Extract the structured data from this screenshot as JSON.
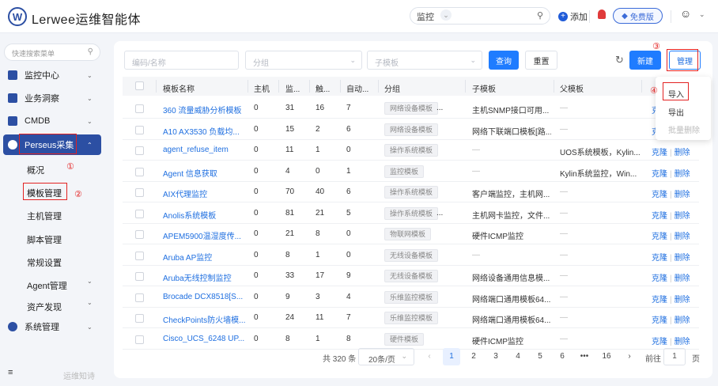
{
  "app": {
    "name": "Lerwee运维智能体",
    "logo_letter": "W"
  },
  "topbar": {
    "search_scope": "监控",
    "add_label": "添加",
    "badge_label": "免费版"
  },
  "sidebar": {
    "search_placeholder": "快速搜索菜单",
    "items": [
      {
        "label": "监控中心"
      },
      {
        "label": "业务洞察"
      },
      {
        "label": "CMDB"
      },
      {
        "label": "Perseus采集"
      },
      {
        "label": "系统管理"
      }
    ],
    "subitems": [
      "概况",
      "模板管理",
      "主机管理",
      "脚本管理",
      "常规设置",
      "Agent管理",
      "资产发现"
    ],
    "footer_label": "运维知诗"
  },
  "annotations": [
    "①",
    "②",
    "③",
    "④"
  ],
  "filters": {
    "name_placeholder": "编码/名称",
    "group_placeholder": "分组",
    "subtemplate_placeholder": "子模板",
    "query_label": "查询",
    "reset_label": "重置",
    "new_label": "新建",
    "manage_label": "管理"
  },
  "manage_menu": [
    "导入",
    "导出",
    "批量删除"
  ],
  "table": {
    "headers": [
      "模板名称",
      "主机",
      "监...",
      "触...",
      "自动...",
      "分组",
      "子模板",
      "父模板"
    ],
    "rows": [
      {
        "name": "360 流量威胁分析模板",
        "host": "0",
        "mon": "31",
        "trig": "16",
        "auto": "7",
        "group": "网络设备模板",
        "group_more": "...",
        "sub": "主机SNMP接口可用...",
        "parent": "—",
        "ops": [
          "克隆",
          "删除"
        ]
      },
      {
        "name": "A10 AX3530 负载均...",
        "host": "0",
        "mon": "15",
        "trig": "2",
        "auto": "6",
        "group": "网络设备模板",
        "group_more": "",
        "sub": "网络下联端口模板[路...",
        "parent": "—",
        "ops": [
          "克隆",
          "删除"
        ]
      },
      {
        "name": "agent_refuse_item",
        "host": "0",
        "mon": "11",
        "trig": "1",
        "auto": "0",
        "group": "操作系统模板",
        "group_more": "",
        "sub": "—",
        "parent": "UOS系统模板，Kylin...",
        "ops": [
          "克隆",
          "删除"
        ]
      },
      {
        "name": "Agent 信息获取",
        "host": "0",
        "mon": "4",
        "trig": "0",
        "auto": "1",
        "group": "监控模板",
        "group_more": "",
        "sub": "—",
        "parent": "Kylin系统监控，Win...",
        "ops": [
          "克隆",
          "删除"
        ]
      },
      {
        "name": "AIX代理监控",
        "host": "0",
        "mon": "70",
        "trig": "40",
        "auto": "6",
        "group": "操作系统模板",
        "group_more": "",
        "sub": "客户端监控，主机网...",
        "parent": "—",
        "ops": [
          "克隆",
          "删除"
        ]
      },
      {
        "name": "Anolis系统模板",
        "host": "0",
        "mon": "81",
        "trig": "21",
        "auto": "5",
        "group": "操作系统模板",
        "group_more": "...",
        "sub": "主机网卡监控，文件...",
        "parent": "—",
        "ops": [
          "克隆",
          "删除"
        ]
      },
      {
        "name": "APEM5900温湿度传...",
        "host": "0",
        "mon": "21",
        "trig": "8",
        "auto": "0",
        "group": "物联网模板",
        "group_more": "",
        "sub": "硬件ICMP监控",
        "parent": "—",
        "ops": [
          "克隆",
          "删除"
        ]
      },
      {
        "name": "Aruba AP监控",
        "host": "0",
        "mon": "8",
        "trig": "1",
        "auto": "0",
        "group": "无线设备模板",
        "group_more": "",
        "sub": "—",
        "parent": "—",
        "ops": [
          "克隆",
          "删除"
        ]
      },
      {
        "name": "Aruba无线控制监控",
        "host": "0",
        "mon": "33",
        "trig": "17",
        "auto": "9",
        "group": "无线设备模板",
        "group_more": "",
        "sub": "网络设备通用信息模...",
        "parent": "—",
        "ops": [
          "克隆",
          "删除"
        ]
      },
      {
        "name": "Brocade DCX8518[S...",
        "host": "0",
        "mon": "9",
        "trig": "3",
        "auto": "4",
        "group": "乐维监控模板",
        "group_more": "",
        "sub": "网络端口通用模板64...",
        "parent": "—",
        "ops": [
          "克隆",
          "删除"
        ]
      },
      {
        "name": "CheckPoints防火墙模...",
        "host": "0",
        "mon": "24",
        "trig": "11",
        "auto": "7",
        "group": "乐维监控模板",
        "group_more": "",
        "sub": "网络端口通用模板64...",
        "parent": "—",
        "ops": [
          "克隆",
          "删除"
        ]
      },
      {
        "name": "Cisco_UCS_6248 UP...",
        "host": "0",
        "mon": "8",
        "trig": "1",
        "auto": "8",
        "group": "硬件模板",
        "group_more": "",
        "sub": "硬件ICMP监控",
        "parent": "—",
        "ops": [
          "克隆",
          "删除"
        ]
      }
    ]
  },
  "pagination": {
    "total": "共 320 条",
    "page_size": "20条/页",
    "pages": [
      "1",
      "2",
      "3",
      "4",
      "5",
      "6",
      "•••",
      "16"
    ],
    "current": "1",
    "goto_label": "前往",
    "goto_value": "1",
    "page_unit": "页"
  }
}
